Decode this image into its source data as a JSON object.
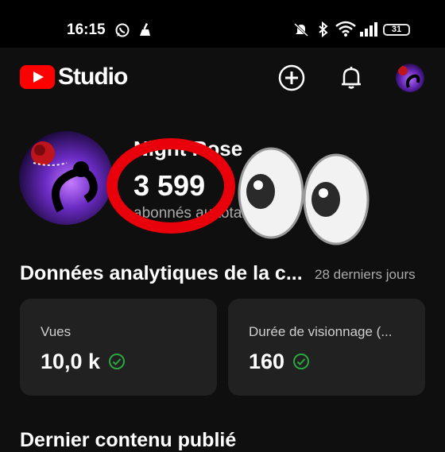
{
  "status_bar": {
    "time": "16:15",
    "battery": "31",
    "icons": [
      "whatsapp-icon",
      "cleaner-icon",
      "mute-icon",
      "bluetooth-icon",
      "wifi-icon",
      "signal-icon"
    ]
  },
  "header": {
    "brand": "Studio",
    "brand_color": "#ff0000",
    "actions": [
      "create-icon",
      "notifications-icon",
      "account-avatar"
    ]
  },
  "channel": {
    "name": "Night Rose",
    "subscriber_count": "3 599",
    "subscriber_label": "abonnés au total"
  },
  "overlays": {
    "highlight_color": "#e8000a",
    "emoji": "eyes"
  },
  "analytics": {
    "title": "Données analytiques de la c...",
    "period": "28 derniers jours",
    "cards": [
      {
        "label": "Vues",
        "value": "10,0 k"
      },
      {
        "label": "Durée de visionnage (...",
        "value": "160"
      }
    ],
    "check_color": "#2ba640"
  },
  "latest": {
    "title": "Dernier contenu publié"
  }
}
